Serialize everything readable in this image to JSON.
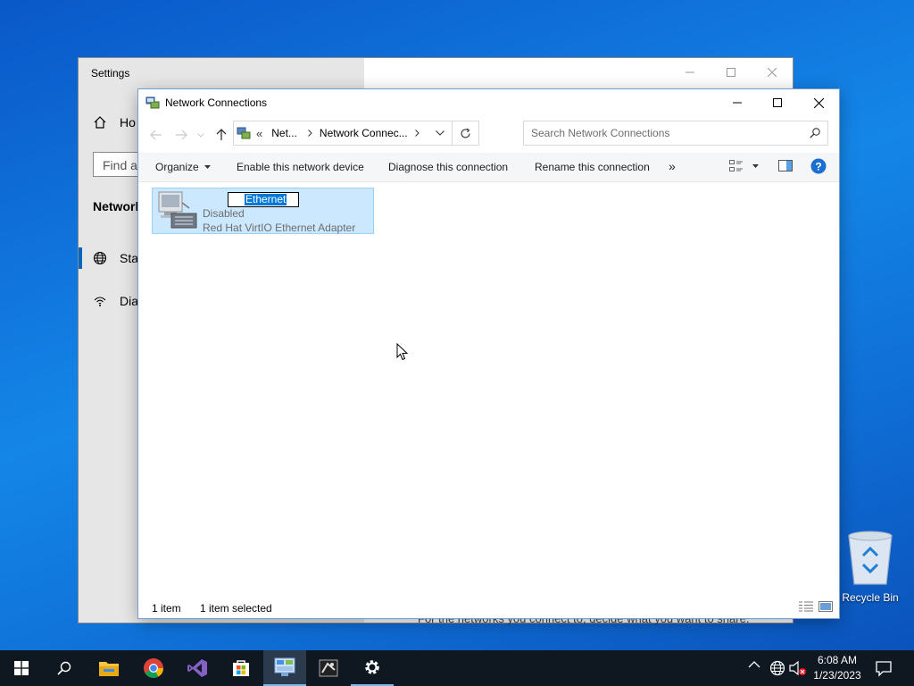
{
  "settings": {
    "title": "Settings",
    "home_label": "Ho",
    "find_placeholder": "Find a",
    "section_label": "Network",
    "status_item": "Stat",
    "dialup_item": "Dia",
    "share_text": "For the networks you connect to, decide what you want to share."
  },
  "network_window": {
    "title": "Network Connections",
    "address": {
      "overflow": "«",
      "crumbs": [
        "Net...",
        "Network Connec..."
      ]
    },
    "search_placeholder": "Search Network Connections",
    "toolbar": {
      "organize": "Organize",
      "enable": "Enable this network device",
      "diagnose": "Diagnose this connection",
      "rename": "Rename this connection",
      "more": "»"
    },
    "connection": {
      "name": "Ethernet",
      "status": "Disabled",
      "adapter": "Red Hat VirtIO Ethernet Adapter"
    },
    "statusbar": {
      "count": "1 item",
      "selected": "1 item selected"
    }
  },
  "desktop": {
    "recycle_bin_label": "Recycle Bin"
  },
  "taskbar": {
    "time": "6:08 AM",
    "date": "1/23/2023"
  },
  "colors": {
    "accent": "#0078d7",
    "selection_bg": "#cce8ff",
    "taskbar_bg": "#0f1721"
  }
}
